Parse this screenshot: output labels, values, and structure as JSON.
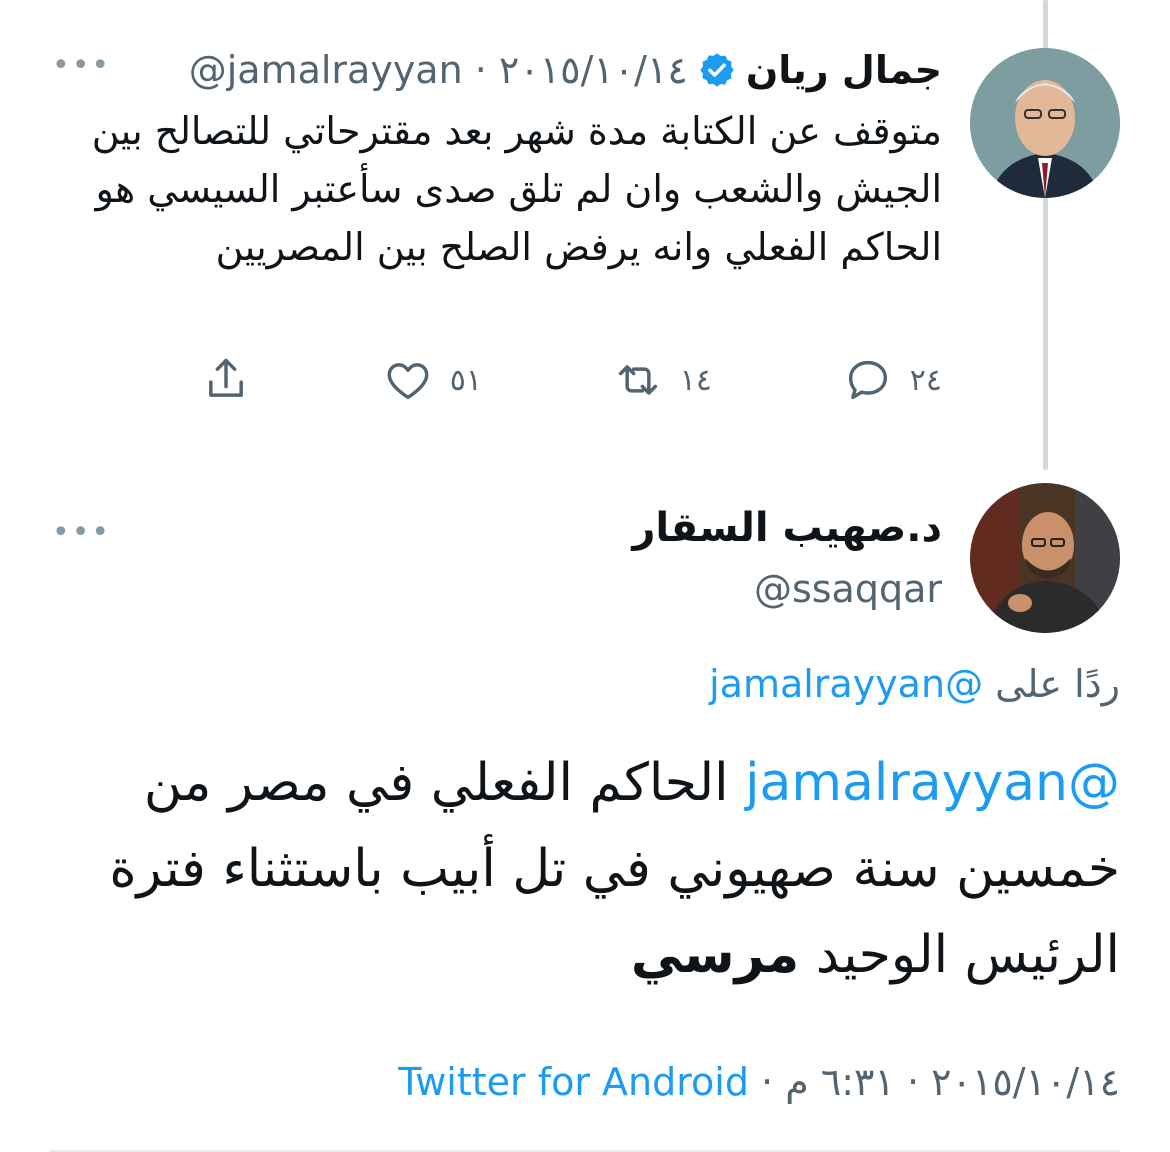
{
  "tweet1": {
    "name": "جمال ريان",
    "handle_date": "@jamalrayyan · ٢٠١٥/١٠/١٤",
    "text": "متوقف عن الكتابة مدة شهر بعد مقترحاتي  للتصالح بين الجيش والشعب وان لم تلق صدى سأعتبر السيسي هو الحاكم الفعلي وانه يرفض الصلح بين المصريين",
    "more": "•••",
    "replies": "٢٤",
    "retweets": "١٤",
    "likes": "٥١"
  },
  "tweet2": {
    "name": "د.صهيب السقار",
    "handle": "@ssaqqar",
    "more": "•••",
    "reply_prefix": "ردًا على",
    "reply_mention": "@jamalrayyan",
    "text_mention": "@jamalrayyan",
    "text_body": " الحاكم الفعلي في مصر من خمسين سنة صهيوني في تل أبيب باستثناء فترة الرئيس الوحيد ",
    "text_bold": "مرسي",
    "date_time": "٢٠١٥/١٠/١٤ · ٦:٣١ م · ",
    "source": "Twitter for Android"
  },
  "colors": {
    "link": "#1d9bf0",
    "muted": "#536471",
    "verified": "#1d9bf0"
  },
  "icons": [
    "reply-icon",
    "retweet-icon",
    "like-icon",
    "share-icon",
    "verified-badge-icon",
    "more-icon"
  ]
}
